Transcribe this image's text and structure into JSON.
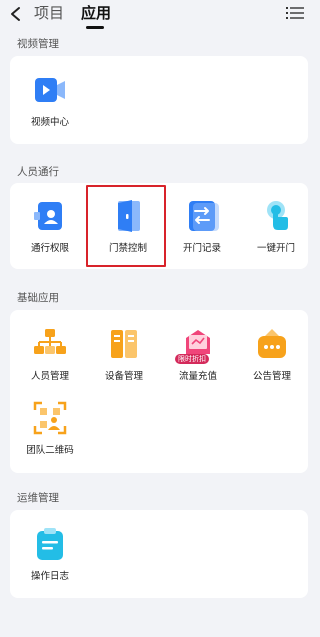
{
  "header": {
    "tabs": [
      {
        "label": "项目",
        "active": false
      },
      {
        "label": "应用",
        "active": true
      }
    ],
    "back_icon": "chevron-left-icon",
    "menu_icon": "list-menu-icon"
  },
  "sections": [
    {
      "title": "视频管理",
      "apps": [
        {
          "label": "视频中心",
          "icon": "video-camera-icon"
        }
      ]
    },
    {
      "title": "人员通行",
      "apps": [
        {
          "label": "通行权限",
          "icon": "access-card-icon"
        },
        {
          "label": "门禁控制",
          "icon": "door-icon",
          "highlighted": true
        },
        {
          "label": "开门记录",
          "icon": "door-record-icon"
        },
        {
          "label": "一键开门",
          "icon": "tap-open-icon"
        }
      ]
    },
    {
      "title": "基础应用",
      "apps": [
        {
          "label": "人员管理",
          "icon": "org-chart-icon"
        },
        {
          "label": "设备管理",
          "icon": "device-cabinet-icon"
        },
        {
          "label": "流量充值",
          "icon": "data-recharge-icon",
          "badge": "限时折扣"
        },
        {
          "label": "公告管理",
          "icon": "announcement-icon"
        },
        {
          "label": "团队二维码",
          "icon": "qr-code-icon"
        }
      ]
    },
    {
      "title": "运维管理",
      "apps": [
        {
          "label": "操作日志",
          "icon": "clipboard-log-icon"
        }
      ]
    }
  ],
  "colors": {
    "background": "#f2f3f7",
    "card": "#ffffff",
    "blue": "#2f7ef5",
    "orange": "#f7a21b",
    "pink": "#f0457a",
    "cyan": "#23bde6",
    "highlight_border": "#d8232a"
  }
}
